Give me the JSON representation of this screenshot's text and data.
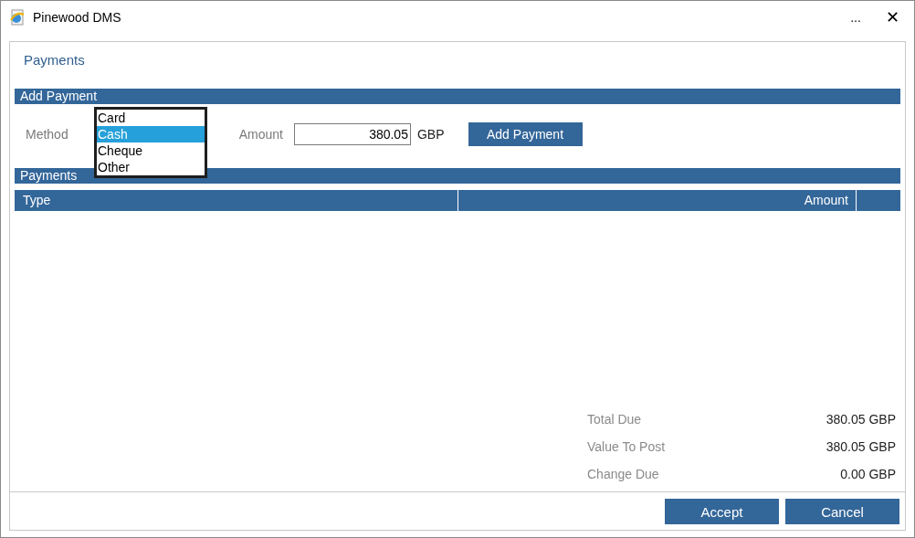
{
  "window": {
    "title": "Pinewood DMS",
    "menu_glyph": "...",
    "close_glyph": "✕"
  },
  "page_title": "Payments",
  "add_section": {
    "title": "Add Payment",
    "method_label": "Method",
    "method_options": [
      {
        "label": "Card",
        "selected": false
      },
      {
        "label": "Cash",
        "selected": true
      },
      {
        "label": "Cheque",
        "selected": false
      },
      {
        "label": "Other",
        "selected": false
      }
    ],
    "amount_label": "Amount",
    "amount_value": "380.05",
    "currency": "GBP",
    "button": "Add Payment"
  },
  "payments_section": {
    "title": "Payments",
    "columns": [
      "Type",
      "Amount"
    ]
  },
  "totals": [
    {
      "label": "Total Due",
      "value": "380.05 GBP"
    },
    {
      "label": "Value To Post",
      "value": "380.05 GBP"
    },
    {
      "label": "Change Due",
      "value": "0.00 GBP"
    }
  ],
  "buttons": [
    "Accept",
    "Cancel"
  ]
}
